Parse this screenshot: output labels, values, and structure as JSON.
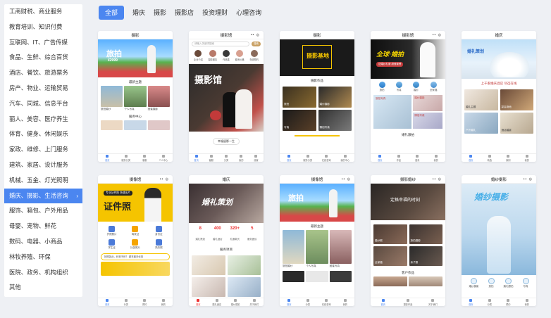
{
  "sidebar": {
    "items": [
      {
        "label": "工商财税、商业服务",
        "active": false
      },
      {
        "label": "教育培训、知识付费",
        "active": false
      },
      {
        "label": "互联网、IT、广告传媒",
        "active": false
      },
      {
        "label": "食品、生鲜、综合百货",
        "active": false
      },
      {
        "label": "酒店、餐饮、旅游票务",
        "active": false
      },
      {
        "label": "房产、物业、运输贸易",
        "active": false
      },
      {
        "label": "汽车、同城、信息平台",
        "active": false
      },
      {
        "label": "丽人、美容、医疗养生",
        "active": false
      },
      {
        "label": "体育、健身、休闲娱乐",
        "active": false
      },
      {
        "label": "家政、维修、上门服务",
        "active": false
      },
      {
        "label": "建筑、家居、设计服务",
        "active": false
      },
      {
        "label": "机械、五金、灯光照明",
        "active": false
      },
      {
        "label": "婚庆、摄影、生活咨询",
        "active": true
      },
      {
        "label": "服饰、箱包、户外用品",
        "active": false
      },
      {
        "label": "母婴、宠物、鲜花",
        "active": false
      },
      {
        "label": "数码、电器、小商品",
        "active": false
      },
      {
        "label": "林牧养殖、环保",
        "active": false
      },
      {
        "label": "医院、政务、机构组织",
        "active": false
      },
      {
        "label": "其他",
        "active": false
      }
    ],
    "active_arrow": "›"
  },
  "tabs": [
    {
      "label": "全部",
      "active": true
    },
    {
      "label": "婚庆",
      "active": false
    },
    {
      "label": "摄影",
      "active": false
    },
    {
      "label": "摄影店",
      "active": false
    },
    {
      "label": "投资理财",
      "active": false
    },
    {
      "label": "心理咨询",
      "active": false
    }
  ],
  "colors": {
    "accent": "#4b86f0",
    "red": "#e33",
    "gold": "#f5c400"
  },
  "cards": {
    "c1": {
      "title": "摄影",
      "banner_text": "旅拍",
      "banner_sub": "¥2999",
      "section1": "最新主题",
      "captions": [
        "旅拍婚纱",
        "个人写真",
        "闺蜜摄影"
      ],
      "section2": "服务中心",
      "tabbar": [
        "首页",
        "服务分类",
        "客服",
        "个人中心"
      ]
    },
    "c2": {
      "title": "摄影馆",
      "search": "请输入关键词搜索",
      "search_btn": "搜索",
      "avatars": [
        "企业介绍",
        "摄影团队",
        "作品集",
        "套系价格",
        "在线预约"
      ],
      "banner_text": "摄影馆",
      "pill": "幸福留影一生",
      "tabbar": [
        "首页",
        "客服",
        "分类",
        "我的",
        "设置"
      ]
    },
    "c3": {
      "title": "摄影",
      "banner_text": "摄影基地",
      "section": "摄影作品",
      "tiles": [
        "旅拍",
        "婚纱摄影",
        "写真",
        "情侣写真"
      ],
      "tabbar": [
        "首页",
        "服务分类",
        "在线咨询",
        "我的中心"
      ]
    },
    "c4": {
      "title": "摄影馆",
      "banner_text": "全球·婚拍",
      "banner_sub": "送婚纱礼服 超值套餐",
      "icons": [
        "旅拍",
        "写真",
        "婚纱",
        "全家福"
      ],
      "tiles": [
        "旅拍写真",
        "婚纱摄影",
        "情侣写真"
      ],
      "section": "婚礼跟拍",
      "tabbar": [
        "首页",
        "作品",
        "套系",
        "我的"
      ]
    },
    "c5": {
      "title": "婚庆",
      "banner_text": "婚礼策划",
      "section": "上千家婚庆酒店 尽选在线",
      "hotels": [
        "婚礼主题",
        "宴会场地",
        "户外婚礼",
        "酒店婚宴"
      ],
      "tabbar": [
        "首页",
        "精选",
        "案例",
        "我的"
      ]
    },
    "c6": {
      "title": "摄像馆",
      "banner_text": "证件照",
      "banner_sub": "专业证件照 快速出片",
      "icons": [
        "护照照片",
        "驾驶证",
        "身份证",
        "学生证",
        "社保照片",
        "简历照"
      ],
      "bar_text": "拍照如此，秒拍不秒？ 超享最多优惠",
      "tabbar": [
        "首页",
        "分类",
        "预约",
        "我的"
      ]
    },
    "c7": {
      "title": "婚庆",
      "banner_text": "婚礼策划",
      "stats": [
        {
          "value": "8",
          "label": "婚礼策划"
        },
        {
          "value": "400",
          "label": "婚礼酒店"
        },
        {
          "value": "320+",
          "label": "礼服款式"
        },
        {
          "value": "5",
          "label": "服务团队"
        }
      ],
      "section": "服务项目",
      "tabbar": [
        "首页",
        "婚礼酒店",
        "婚纱摄影",
        "关于我们"
      ]
    },
    "c8": {
      "title": "摄像馆",
      "banner_text": "旅拍",
      "section": "最新主题",
      "captions": [
        "旅拍婚纱",
        "个人写真",
        "闺蜜写真"
      ],
      "tabbar": [
        "首页",
        "分类",
        "在线咨询",
        "我的"
      ]
    },
    "c9": {
      "title": "摄影婚纱",
      "banner_text": "定格幸福的时刻",
      "tiles": [
        "婚纱照",
        "旅拍摄影",
        "全家福",
        "亲子照"
      ],
      "section": "客户作品",
      "tabbar": [
        "首页",
        "摄影作品",
        "关于我们"
      ]
    },
    "c10": {
      "title": "婚纱摄影",
      "banner_text": "婚纱摄影",
      "icons": [
        "婚纱摄影",
        "旅拍",
        "婚礼跟拍",
        "写真"
      ],
      "tabbar": [
        "首页",
        "分类",
        "预约",
        "我的"
      ]
    }
  }
}
